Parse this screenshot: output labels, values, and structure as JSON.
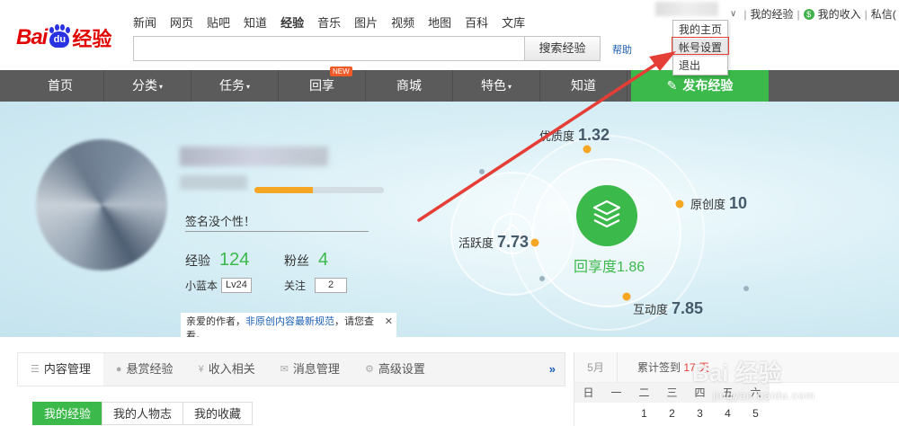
{
  "logo": {
    "text_bai": "Bai",
    "text_du": "du",
    "text_jy": "经验"
  },
  "topnav": [
    "新闻",
    "网页",
    "贴吧",
    "知道",
    "经验",
    "音乐",
    "图片",
    "视频",
    "地图",
    "百科",
    "文库"
  ],
  "topnav_active": "经验",
  "search": {
    "placeholder": "",
    "button": "搜索经验",
    "help": "帮助"
  },
  "userbar": {
    "my_exp": "我的经验",
    "my_income": "我的收入",
    "messages": "私信(",
    "sep": "|",
    "coin_glyph": "$"
  },
  "dropdown": {
    "items": [
      "我的主页",
      "帐号设置",
      "退出"
    ],
    "highlighted": "帐号设置"
  },
  "mainnav": {
    "items": [
      {
        "label": "首页",
        "caret": false
      },
      {
        "label": "分类",
        "caret": true
      },
      {
        "label": "任务",
        "caret": true
      },
      {
        "label": "回享",
        "caret": false,
        "badge": "NEW"
      },
      {
        "label": "商城",
        "caret": false
      },
      {
        "label": "特色",
        "caret": true
      },
      {
        "label": "知道",
        "caret": false
      }
    ],
    "publish": "发布经验",
    "caret_glyph": "▾"
  },
  "profile": {
    "signature": "签名没个性！",
    "level_progress": 0.45,
    "exp_label": "经验",
    "exp_value": "124",
    "fans_label": "粉丝",
    "fans_value": "4",
    "lanben_label": "小蓝本",
    "lanben_value": "Lv24",
    "follow_label": "关注",
    "follow_value": "2",
    "notice_prefix": "亲爱的作者，",
    "notice_link": "非原创内容最新规范",
    "notice_suffix": "，请您查看。",
    "notice_close": "✕"
  },
  "metrics": {
    "youzhi": {
      "label": "优质度",
      "value": "1.32"
    },
    "yuanchuang": {
      "label": "原创度",
      "value": "10"
    },
    "huoyue": {
      "label": "活跃度",
      "value": "7.73"
    },
    "hudong": {
      "label": "互动度",
      "value": "7.85"
    },
    "huixiang": {
      "label": "回享度",
      "value": "1.86"
    }
  },
  "colors": {
    "accent_green": "#3cb94b",
    "nav_gray": "#5b5b5b",
    "highlight_red": "#e53e36",
    "link_blue": "#1a5fb4"
  },
  "tabs": [
    {
      "label": "内容管理",
      "icon": "list-icon",
      "icon_glyph": "☰"
    },
    {
      "label": "悬赏经验",
      "icon": "coin-icon",
      "icon_glyph": "●"
    },
    {
      "label": "收入相关",
      "icon": "yuan-icon",
      "icon_glyph": "¥"
    },
    {
      "label": "消息管理",
      "icon": "mail-icon",
      "icon_glyph": "✉"
    },
    {
      "label": "高级设置",
      "icon": "gear-icon",
      "icon_glyph": "⚙"
    }
  ],
  "tabs_more": "»",
  "subtabs": [
    "我的经验",
    "我的人物志",
    "我的收藏"
  ],
  "calendar": {
    "month": "5月",
    "sign_prefix": "累计签到",
    "sign_count": "17",
    "sign_more": "天",
    "weekdays": [
      "日",
      "一",
      "二",
      "三",
      "四",
      "五",
      "六"
    ],
    "days": [
      "",
      "",
      "1",
      "2",
      "3",
      "4",
      "5"
    ]
  },
  "watermark": {
    "text": "Bai 经验",
    "url": "jingyan.baidu.com"
  }
}
